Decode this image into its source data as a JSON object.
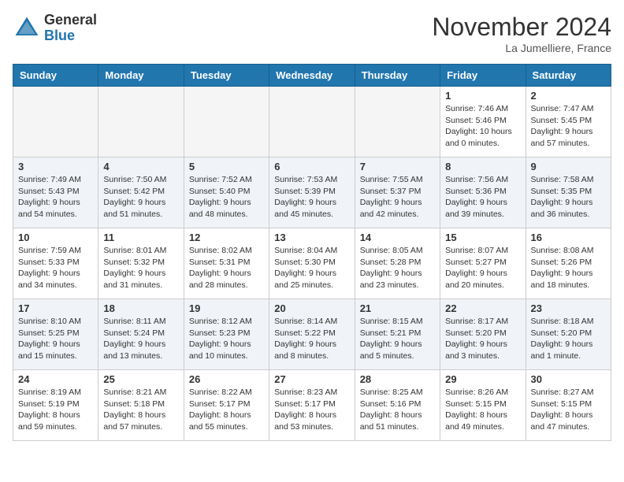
{
  "logo": {
    "general": "General",
    "blue": "Blue"
  },
  "title": "November 2024",
  "location": "La Jumelliere, France",
  "weekdays": [
    "Sunday",
    "Monday",
    "Tuesday",
    "Wednesday",
    "Thursday",
    "Friday",
    "Saturday"
  ],
  "weeks": [
    [
      {
        "day": "",
        "info": ""
      },
      {
        "day": "",
        "info": ""
      },
      {
        "day": "",
        "info": ""
      },
      {
        "day": "",
        "info": ""
      },
      {
        "day": "",
        "info": ""
      },
      {
        "day": "1",
        "info": "Sunrise: 7:46 AM\nSunset: 5:46 PM\nDaylight: 10 hours\nand 0 minutes."
      },
      {
        "day": "2",
        "info": "Sunrise: 7:47 AM\nSunset: 5:45 PM\nDaylight: 9 hours\nand 57 minutes."
      }
    ],
    [
      {
        "day": "3",
        "info": "Sunrise: 7:49 AM\nSunset: 5:43 PM\nDaylight: 9 hours\nand 54 minutes."
      },
      {
        "day": "4",
        "info": "Sunrise: 7:50 AM\nSunset: 5:42 PM\nDaylight: 9 hours\nand 51 minutes."
      },
      {
        "day": "5",
        "info": "Sunrise: 7:52 AM\nSunset: 5:40 PM\nDaylight: 9 hours\nand 48 minutes."
      },
      {
        "day": "6",
        "info": "Sunrise: 7:53 AM\nSunset: 5:39 PM\nDaylight: 9 hours\nand 45 minutes."
      },
      {
        "day": "7",
        "info": "Sunrise: 7:55 AM\nSunset: 5:37 PM\nDaylight: 9 hours\nand 42 minutes."
      },
      {
        "day": "8",
        "info": "Sunrise: 7:56 AM\nSunset: 5:36 PM\nDaylight: 9 hours\nand 39 minutes."
      },
      {
        "day": "9",
        "info": "Sunrise: 7:58 AM\nSunset: 5:35 PM\nDaylight: 9 hours\nand 36 minutes."
      }
    ],
    [
      {
        "day": "10",
        "info": "Sunrise: 7:59 AM\nSunset: 5:33 PM\nDaylight: 9 hours\nand 34 minutes."
      },
      {
        "day": "11",
        "info": "Sunrise: 8:01 AM\nSunset: 5:32 PM\nDaylight: 9 hours\nand 31 minutes."
      },
      {
        "day": "12",
        "info": "Sunrise: 8:02 AM\nSunset: 5:31 PM\nDaylight: 9 hours\nand 28 minutes."
      },
      {
        "day": "13",
        "info": "Sunrise: 8:04 AM\nSunset: 5:30 PM\nDaylight: 9 hours\nand 25 minutes."
      },
      {
        "day": "14",
        "info": "Sunrise: 8:05 AM\nSunset: 5:28 PM\nDaylight: 9 hours\nand 23 minutes."
      },
      {
        "day": "15",
        "info": "Sunrise: 8:07 AM\nSunset: 5:27 PM\nDaylight: 9 hours\nand 20 minutes."
      },
      {
        "day": "16",
        "info": "Sunrise: 8:08 AM\nSunset: 5:26 PM\nDaylight: 9 hours\nand 18 minutes."
      }
    ],
    [
      {
        "day": "17",
        "info": "Sunrise: 8:10 AM\nSunset: 5:25 PM\nDaylight: 9 hours\nand 15 minutes."
      },
      {
        "day": "18",
        "info": "Sunrise: 8:11 AM\nSunset: 5:24 PM\nDaylight: 9 hours\nand 13 minutes."
      },
      {
        "day": "19",
        "info": "Sunrise: 8:12 AM\nSunset: 5:23 PM\nDaylight: 9 hours\nand 10 minutes."
      },
      {
        "day": "20",
        "info": "Sunrise: 8:14 AM\nSunset: 5:22 PM\nDaylight: 9 hours\nand 8 minutes."
      },
      {
        "day": "21",
        "info": "Sunrise: 8:15 AM\nSunset: 5:21 PM\nDaylight: 9 hours\nand 5 minutes."
      },
      {
        "day": "22",
        "info": "Sunrise: 8:17 AM\nSunset: 5:20 PM\nDaylight: 9 hours\nand 3 minutes."
      },
      {
        "day": "23",
        "info": "Sunrise: 8:18 AM\nSunset: 5:20 PM\nDaylight: 9 hours\nand 1 minute."
      }
    ],
    [
      {
        "day": "24",
        "info": "Sunrise: 8:19 AM\nSunset: 5:19 PM\nDaylight: 8 hours\nand 59 minutes."
      },
      {
        "day": "25",
        "info": "Sunrise: 8:21 AM\nSunset: 5:18 PM\nDaylight: 8 hours\nand 57 minutes."
      },
      {
        "day": "26",
        "info": "Sunrise: 8:22 AM\nSunset: 5:17 PM\nDaylight: 8 hours\nand 55 minutes."
      },
      {
        "day": "27",
        "info": "Sunrise: 8:23 AM\nSunset: 5:17 PM\nDaylight: 8 hours\nand 53 minutes."
      },
      {
        "day": "28",
        "info": "Sunrise: 8:25 AM\nSunset: 5:16 PM\nDaylight: 8 hours\nand 51 minutes."
      },
      {
        "day": "29",
        "info": "Sunrise: 8:26 AM\nSunset: 5:15 PM\nDaylight: 8 hours\nand 49 minutes."
      },
      {
        "day": "30",
        "info": "Sunrise: 8:27 AM\nSunset: 5:15 PM\nDaylight: 8 hours\nand 47 minutes."
      }
    ]
  ]
}
